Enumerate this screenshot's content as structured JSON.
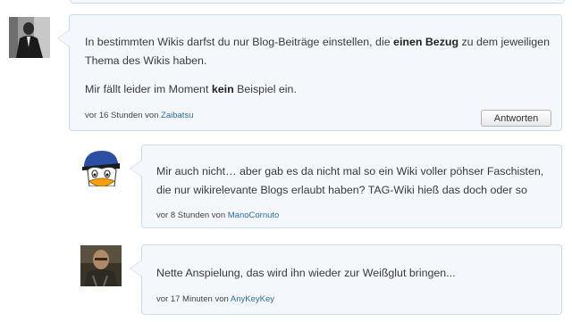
{
  "comments": [
    {
      "avatar_icon": "man-in-suit-photo-icon",
      "paragraphs": [
        [
          "In bestimmten Wikis darfst du nur Blog-Beiträge einstellen, die ",
          "einen Bezug",
          " zu dem jeweiligen"
        ],
        [
          "Thema des Wikis haben.",
          "",
          ""
        ],
        [
          "Mir fällt leider im Moment ",
          "kein",
          " Beispiel ein."
        ]
      ],
      "time": "vor 16 Stunden von",
      "author": "Zaibatsu",
      "reply_label": "Antworten"
    },
    {
      "avatar_icon": "cartoon-duck-icon",
      "paragraphs": [
        [
          "Mir auch nicht… aber gab es da nicht mal so ein Wiki voller pöhser Faschisten,",
          "",
          ""
        ],
        [
          "die nur wikirelevante Blogs erlaubt haben? TAG-Wiki hieß das doch oder so",
          "",
          ""
        ]
      ],
      "time": "vor 8 Stunden von",
      "author": "ManoCornuto"
    },
    {
      "avatar_icon": "bald-man-photo-icon",
      "paragraphs": [
        [
          "Nette Anspielung, das wird ihn wieder zur Weißglut bringen...",
          "",
          ""
        ]
      ],
      "time": "vor 17 Minuten von",
      "author": "AnyKeyKey"
    }
  ]
}
